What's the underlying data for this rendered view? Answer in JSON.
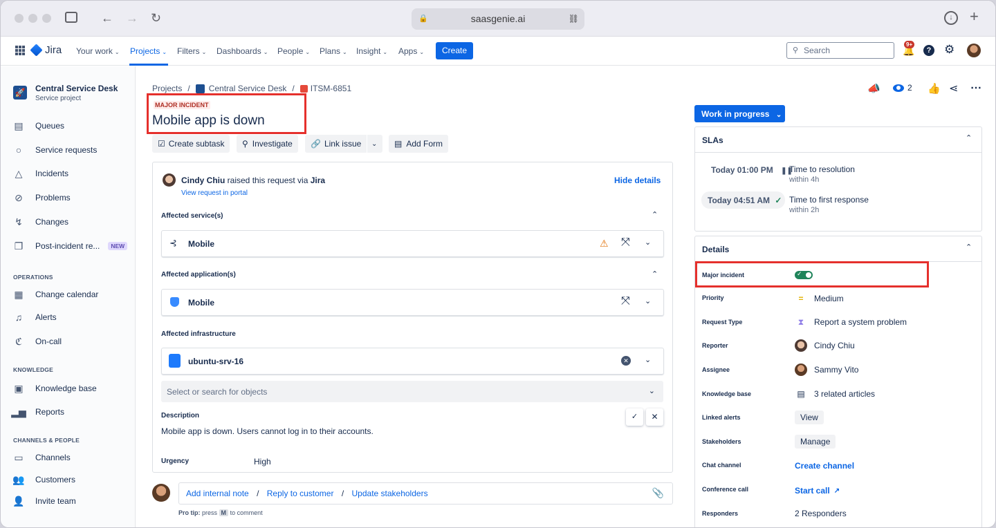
{
  "browser": {
    "url": "saasgenie.ai"
  },
  "topnav": {
    "brand": "Jira",
    "items": [
      "Your work",
      "Projects",
      "Filters",
      "Dashboards",
      "People",
      "Plans",
      "Insight",
      "Apps"
    ],
    "create_label": "Create",
    "search_placeholder": "Search",
    "notif_badge": "9+"
  },
  "sidebar": {
    "project_name": "Central Service Desk",
    "project_type": "Service project",
    "items": [
      "Queues",
      "Service requests",
      "Incidents",
      "Problems",
      "Changes",
      "Post-incident re..."
    ],
    "new_badge": "NEW",
    "sec_operations": "OPERATIONS",
    "operations": [
      "Change calendar",
      "Alerts",
      "On-call"
    ],
    "sec_knowledge": "KNOWLEDGE",
    "knowledge": [
      "Knowledge base",
      "Reports"
    ],
    "sec_channels": "CHANNELS & PEOPLE",
    "channels": [
      "Channels",
      "Customers",
      "Invite team"
    ]
  },
  "breadcrumb": {
    "projects": "Projects",
    "sep": "/",
    "project": "Central Service Desk",
    "issue": "ITSM-6851"
  },
  "issue": {
    "tag": "MAJOR INCIDENT",
    "title": "Mobile app is down",
    "actions": [
      "Create subtask",
      "Investigate",
      "Link issue",
      "Add Form"
    ],
    "watch_count": "2"
  },
  "request": {
    "reporter": "Cindy Chiu",
    "raised_text": "raised this request via",
    "channel": "Jira",
    "view_portal": "View request in portal",
    "hide_details": "Hide details",
    "affected_services_label": "Affected service(s)",
    "service": "Mobile",
    "affected_apps_label": "Affected application(s)",
    "application": "Mobile",
    "affected_infra_label": "Affected infrastructure",
    "infra": "ubuntu-srv-16",
    "search_placeholder": "Select or search for objects",
    "description_label": "Description",
    "description": "Mobile app is down. Users cannot log in to their accounts.",
    "urgency_label": "Urgency",
    "urgency": "High"
  },
  "comment": {
    "add_note": "Add internal note",
    "reply": "Reply to customer",
    "update": "Update stakeholders",
    "sep": "/",
    "tip_prefix": "Pro tip:",
    "tip_press": "press",
    "tip_key": "M",
    "tip_suffix": "to comment"
  },
  "status": {
    "label": "Work in progress"
  },
  "slas": {
    "title": "SLAs",
    "items": [
      {
        "time": "Today 01:00 PM",
        "name": "Time to resolution",
        "sub": "within 4h"
      },
      {
        "time": "Today 04:51 AM",
        "name": "Time to first response",
        "sub": "within 2h"
      }
    ]
  },
  "details": {
    "title": "Details",
    "major_incident_label": "Major incident",
    "major_incident_on": true,
    "priority_label": "Priority",
    "priority": "Medium",
    "request_type_label": "Request Type",
    "request_type": "Report a system problem",
    "reporter_label": "Reporter",
    "reporter": "Cindy Chiu",
    "assignee_label": "Assignee",
    "assignee": "Sammy Vito",
    "kb_label": "Knowledge base",
    "kb": "3 related articles",
    "alerts_label": "Linked alerts",
    "alerts": "View",
    "stake_label": "Stakeholders",
    "stake": "Manage",
    "chat_label": "Chat channel",
    "chat": "Create channel",
    "conf_label": "Conference call",
    "conf": "Start call",
    "resp_label": "Responders",
    "resp": "2 Responders"
  },
  "colors": {
    "accent": "#0c66e4",
    "highlight": "#e5302c",
    "toggle": "#1f845a"
  }
}
